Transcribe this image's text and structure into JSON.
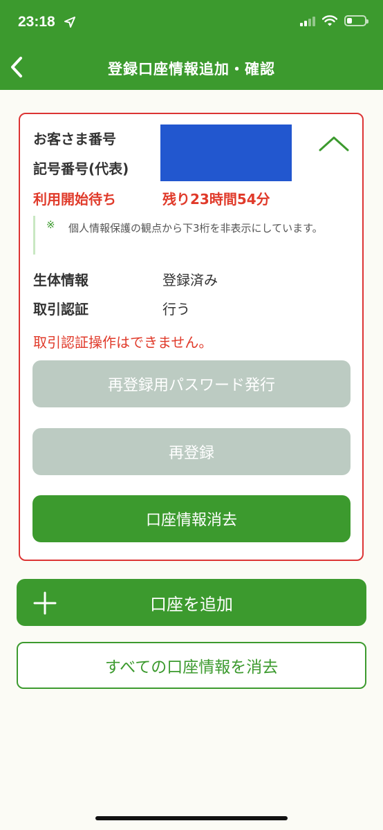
{
  "status_bar": {
    "time": "23:18",
    "icons": [
      "location-arrow-icon",
      "signal-icon",
      "wifi-icon",
      "battery-icon"
    ]
  },
  "nav": {
    "title": "登録口座情報追加・確認",
    "back_icon": "chevron-left-icon"
  },
  "account_card": {
    "customer_number_label": "お客さま番号",
    "account_number_label": "記号番号(代表)",
    "status": "利用開始待ち",
    "remaining": "残り23時間54分",
    "collapse_icon": "chevron-up-icon",
    "note_mark": "※",
    "note": "個人情報保護の観点から下3桁を非表示にしています。",
    "biometric_label": "生体情報",
    "biometric_value": "登録済み",
    "txn_auth_label": "取引認証",
    "txn_auth_value": "行う",
    "warning": "取引認証操作はできません。",
    "reissue_password_button": "再登録用パスワード発行",
    "reregister_button": "再登録",
    "delete_account_button": "口座情報消去"
  },
  "actions": {
    "add_account_button": "口座を追加",
    "add_icon": "plus-icon",
    "delete_all_button": "すべての口座情報を消去"
  },
  "colors": {
    "brand_green": "#3c9a2e",
    "alert_red": "#e03a2a",
    "disabled_gray": "#bccbc2",
    "mask_blue": "#2257cf"
  }
}
